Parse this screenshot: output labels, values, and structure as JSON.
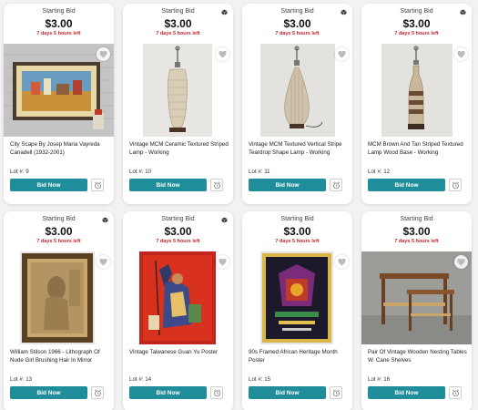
{
  "cards": [
    {
      "starting_bid_label": "Starting Bid",
      "price": "$3.00",
      "time_left": "7 days 5 hours left",
      "has_cube_icon": false,
      "image_icon": "framed-painting",
      "title": "City Scape By Josep Maria Vayreda Canadell (1932-2001)",
      "lot": "Lot #: 9",
      "bid_label": "Bid Now"
    },
    {
      "starting_bid_label": "Starting Bid",
      "price": "$3.00",
      "time_left": "7 days 5 hours left",
      "has_cube_icon": true,
      "image_icon": "ceramic-lamp",
      "title": "Vintage MCM Ceramic Textured Striped Lamp - Working",
      "lot": "Lot #: 10",
      "bid_label": "Bid Now"
    },
    {
      "starting_bid_label": "Starting Bid",
      "price": "$3.00",
      "time_left": "7 days 5 hours left",
      "has_cube_icon": true,
      "image_icon": "teardrop-lamp",
      "title": "Vintage MCM Textured Vertical Stripe Teardrop Shape Lamp - Working",
      "lot": "Lot #: 11",
      "bid_label": "Bid Now"
    },
    {
      "starting_bid_label": "Starting Bid",
      "price": "$3.00",
      "time_left": "7 days 5 hours left",
      "has_cube_icon": true,
      "image_icon": "striped-lamp",
      "title": "MCM Brown And Tan Striped Textured Lamp Wood Base - Working",
      "lot": "Lot #: 12",
      "bid_label": "Bid Now"
    },
    {
      "starting_bid_label": "Starting Bid",
      "price": "$3.00",
      "time_left": "7 days 5 hours left",
      "has_cube_icon": true,
      "image_icon": "framed-lithograph",
      "title": "William Stilson 1966 - Lithograph Of Nude Girl Brushing Hair In Mirror",
      "lot": "Lot #: 13",
      "bid_label": "Bid Now"
    },
    {
      "starting_bid_label": "Starting Bid",
      "price": "$3.00",
      "time_left": "7 days 5 hours left",
      "has_cube_icon": true,
      "image_icon": "red-poster",
      "title": "Vintage Taiwanese Guan Yu Poster",
      "lot": "Lot #: 14",
      "bid_label": "Bid Now"
    },
    {
      "starting_bid_label": "Starting Bid",
      "price": "$3.00",
      "time_left": "7 days 5 hours left",
      "has_cube_icon": false,
      "image_icon": "framed-poster",
      "title": "90s Framed African Heritage Month Poster",
      "lot": "Lot #: 15",
      "bid_label": "Bid Now"
    },
    {
      "starting_bid_label": "Starting Bid",
      "price": "$3.00",
      "time_left": "7 days 5 hours left",
      "has_cube_icon": false,
      "image_icon": "nesting-tables",
      "title": "Pair Of Vintage Wooden Nesting Tables W. Cane Shelves",
      "lot": "Lot #: 16",
      "bid_label": "Bid Now"
    }
  ],
  "colors": {
    "accent": "#1f8e9a",
    "time_left": "#c0262d"
  }
}
